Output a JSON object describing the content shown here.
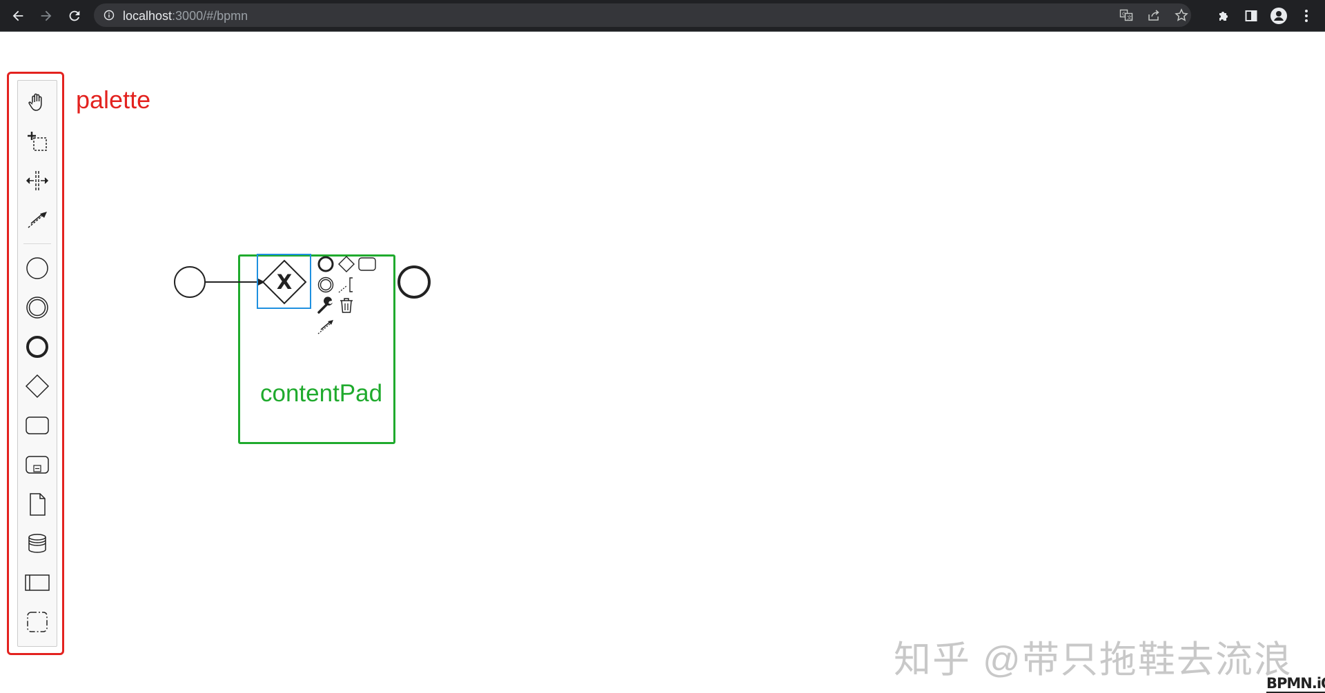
{
  "browser": {
    "url_host": "localhost",
    "url_rest": ":3000/#/bpmn",
    "icons": [
      "back-arrow-icon",
      "forward-arrow-icon",
      "reload-icon",
      "info-icon",
      "translate-icon",
      "share-icon",
      "star-icon",
      "extensions-icon",
      "side-panel-icon",
      "profile-icon",
      "more-vert-icon"
    ]
  },
  "annotations": {
    "palette_label": "palette",
    "contentpad_label": "contentPad",
    "palette_highlight_color": "#e3221f",
    "contentpad_highlight_color": "#1faa2d"
  },
  "palette": {
    "tools": [
      "hand-tool-icon",
      "lasso-tool-icon",
      "space-tool-icon",
      "global-connect-tool-icon"
    ],
    "elements": [
      "start-event-icon",
      "intermediate-event-icon",
      "end-event-icon",
      "gateway-icon",
      "task-icon",
      "subprocess-icon",
      "data-object-icon",
      "data-store-icon",
      "participant-icon",
      "group-icon"
    ]
  },
  "diagram": {
    "start_event": "start-event",
    "gateway_marker": "X",
    "end_event": "end-event",
    "selection_color": "#1e90e0"
  },
  "context_pad": {
    "entries": [
      "append-end-event-icon",
      "append-gateway-icon",
      "append-task-icon",
      "append-intermediate-event-icon",
      "append-text-annotation-icon",
      "replace-wrench-icon",
      "delete-trash-icon",
      "connect-icon"
    ]
  },
  "watermark": "知乎 @带只拖鞋去流浪",
  "logo": "BPMN.iO"
}
